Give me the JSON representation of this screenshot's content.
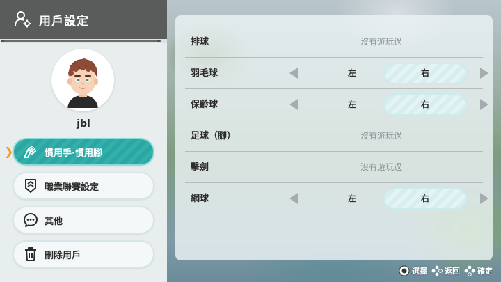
{
  "header": {
    "title": "用戶設定"
  },
  "profile": {
    "username": "jbl"
  },
  "menu": [
    {
      "label": "慣用手·慣用腳",
      "icon": "hands-icon",
      "active": true
    },
    {
      "label": "職業聯賽設定",
      "icon": "rank-icon",
      "active": false
    },
    {
      "label": "其他",
      "icon": "ellipsis-icon",
      "active": false
    },
    {
      "label": "刪除用戶",
      "icon": "trash-icon",
      "active": false
    }
  ],
  "settings": [
    {
      "label": "排球",
      "status": "沒有遊玩過"
    },
    {
      "label": "羽毛球",
      "left": "左",
      "right": "右"
    },
    {
      "label": "保齡球",
      "left": "左",
      "right": "右"
    },
    {
      "label": "足球（腳）",
      "status": "沒有遊玩過"
    },
    {
      "label": "擊劍",
      "status": "沒有遊玩過"
    },
    {
      "label": "網球",
      "left": "左",
      "right": "右"
    }
  ],
  "footer": {
    "select": "選擇",
    "back": "返回",
    "confirm": "確定"
  },
  "colors": {
    "accent": "#2aa7a2",
    "header": "#5a5c5c",
    "cursor": "#f0a020"
  }
}
